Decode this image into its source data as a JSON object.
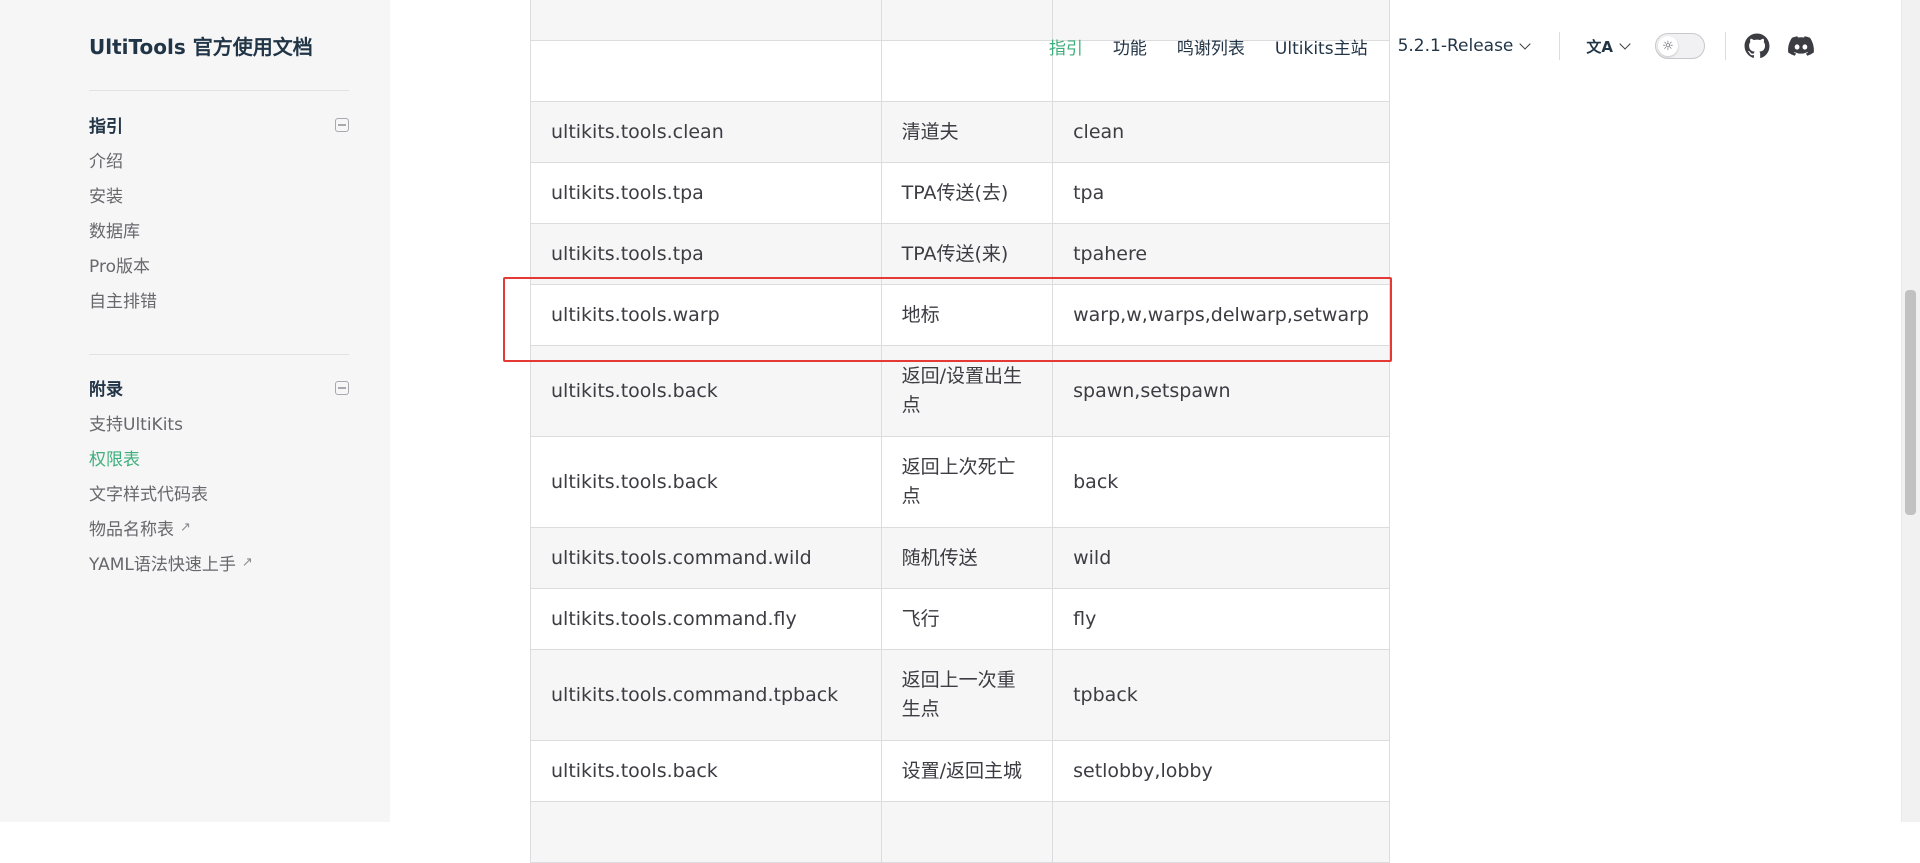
{
  "site": {
    "title": "UltiTools 官方使用文档"
  },
  "sidebar": {
    "groups": [
      {
        "title": "指引",
        "items": [
          {
            "label": "介绍",
            "external": false,
            "active": false
          },
          {
            "label": "安装",
            "external": false,
            "active": false
          },
          {
            "label": "数据库",
            "external": false,
            "active": false
          },
          {
            "label": "Pro版本",
            "external": false,
            "active": false
          },
          {
            "label": "自主排错",
            "external": false,
            "active": false
          }
        ]
      },
      {
        "title": "附录",
        "items": [
          {
            "label": "支持UltiKits",
            "external": false,
            "active": false
          },
          {
            "label": "权限表",
            "external": false,
            "active": true
          },
          {
            "label": "文字样式代码表",
            "external": false,
            "active": false
          },
          {
            "label": "物品名称表",
            "external": true,
            "active": false
          },
          {
            "label": "YAML语法快速上手",
            "external": true,
            "active": false
          }
        ]
      }
    ]
  },
  "nav": {
    "links": [
      {
        "label": "指引",
        "active": true
      },
      {
        "label": "功能",
        "active": false
      },
      {
        "label": "鸣谢列表",
        "active": false
      },
      {
        "label": "Ultikits主站",
        "active": false
      }
    ],
    "version": "5.2.1-Release",
    "translate_icon": "文A",
    "theme_icon": "sun-icon",
    "social": [
      "github-icon",
      "discord-icon"
    ]
  },
  "table": {
    "rows": [
      {
        "perm": "",
        "desc": "",
        "cmd": "",
        "ghost": true
      },
      {
        "perm": "",
        "desc": "",
        "cmd": "",
        "ghost": true
      },
      {
        "perm": "ultikits.tools.clean",
        "desc": "清道夫",
        "cmd": "clean"
      },
      {
        "perm": "ultikits.tools.tpa",
        "desc": "TPA传送(去)",
        "cmd": "tpa"
      },
      {
        "perm": "ultikits.tools.tpa",
        "desc": "TPA传送(来)",
        "cmd": "tpahere"
      },
      {
        "perm": "ultikits.tools.warp",
        "desc": "地标",
        "cmd": "warp,w,warps,delwarp,setwarp"
      },
      {
        "perm": "ultikits.tools.back",
        "desc": "返回/设置出生点",
        "cmd": "spawn,setspawn"
      },
      {
        "perm": "ultikits.tools.back",
        "desc": "返回上次死亡点",
        "cmd": "back"
      },
      {
        "perm": "ultikits.tools.command.wild",
        "desc": "随机传送",
        "cmd": "wild"
      },
      {
        "perm": "ultikits.tools.command.fly",
        "desc": "飞行",
        "cmd": "fly"
      },
      {
        "perm": "ultikits.tools.command.tpback",
        "desc": "返回上一次重生点",
        "cmd": "tpback"
      },
      {
        "perm": "ultikits.tools.back",
        "desc": "设置/返回主城",
        "cmd": "setlobby,lobby"
      },
      {
        "perm": "",
        "desc": "",
        "cmd": "",
        "ghost": true
      }
    ]
  },
  "colors": {
    "accent": "#3eaf7c",
    "highlight": "#e53935"
  }
}
